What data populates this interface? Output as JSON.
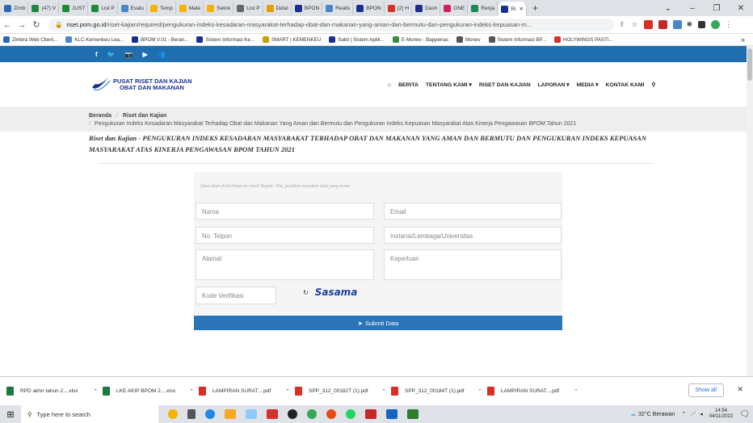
{
  "browser": {
    "tabs": [
      {
        "label": "Zimb",
        "color": "#2a6ab5"
      },
      {
        "label": "(47) V",
        "color": "#1b8a3a"
      },
      {
        "label": "JUST",
        "color": "#1b8a3a"
      },
      {
        "label": "List P",
        "color": "#1b8a3a"
      },
      {
        "label": "Evalu",
        "color": "#4a86c8"
      },
      {
        "label": "Temp",
        "color": "#f4b400"
      },
      {
        "label": "Mate",
        "color": "#f4b400"
      },
      {
        "label": "Sekre",
        "color": "#f4b400"
      },
      {
        "label": "List P",
        "color": "#666666"
      },
      {
        "label": "Detai",
        "color": "#e8a000"
      },
      {
        "label": "BPON",
        "color": "#1a2f8f"
      },
      {
        "label": "Realis",
        "color": "#4a86c8"
      },
      {
        "label": "BPON",
        "color": "#1a2f8f"
      },
      {
        "label": "(2) H",
        "color": "#d93025"
      },
      {
        "label": "Dash",
        "color": "#1a2f8f"
      },
      {
        "label": "ONE",
        "color": "#d81b60"
      },
      {
        "label": "Renja",
        "color": "#1a8a55"
      },
      {
        "label": "Ri",
        "color": "#1a2f8f",
        "active": true
      }
    ],
    "new_tab": "+",
    "url_host": "riset.pom.go.id",
    "url_path": "/riset-kajian/required/pengukuran-indeks-kesadaran-masyarakat-terhadap-obat-dan-makanan-yang-aman-dan-bermutu-dan-pengukuran-indeks-kepuasan-m...",
    "bookmarks": [
      {
        "label": "Zimbra Web Client...",
        "color": "#2a6ab5"
      },
      {
        "label": "KLC-Kemenkeu Lea...",
        "color": "#4a86c8"
      },
      {
        "label": "BPOM V.01 - Beran...",
        "color": "#1a2f8f"
      },
      {
        "label": "Sistem Informasi Ke...",
        "color": "#1a2f8f"
      },
      {
        "label": "SMART | KEMENKEU",
        "color": "#c8a000"
      },
      {
        "label": "Sakti | Sistem Aplik...",
        "color": "#1a2f8f"
      },
      {
        "label": "E-Monev - Bappenas",
        "color": "#3c8a3c"
      },
      {
        "label": "Monev",
        "color": "#555555"
      },
      {
        "label": "Sistem Informasi BP...",
        "color": "#555555"
      },
      {
        "label": "HOLYWINGS PASTI...",
        "color": "#d93025"
      }
    ],
    "bookmarks_more": "»"
  },
  "site": {
    "logo_line1": "PUSAT RISET DAN KAJIAN",
    "logo_line2": "OBAT DAN MAKANAN",
    "nav": [
      {
        "label": "BERITA",
        "dropdown": false
      },
      {
        "label": "TENTANG KAMI",
        "dropdown": true
      },
      {
        "label": "RISET DAN KAJIAN",
        "dropdown": false
      },
      {
        "label": "LAPORAN",
        "dropdown": true
      },
      {
        "label": "MEDIA",
        "dropdown": true
      },
      {
        "label": "KONTAK KAMI",
        "dropdown": false
      }
    ],
    "social": [
      "f",
      "🐦",
      "📷",
      "▶",
      "👥"
    ]
  },
  "breadcrumb": {
    "home": "Beranda",
    "section": "Riset dan Kajian",
    "current": "Pengukuran Indeks Kesadaran Masyarakat Terhadap Obat dan Makanan Yang Aman dan Bermutu dan Pengukuran Indeks Kepuasan Masyarakat Atas Kinerja Pengawasan BPOM Tahun 2021",
    "separator": "/"
  },
  "heading": "Riset dan Kajian - PENGUKURAN INDEKS KESADARAN MASYARAKAT TERHADAP OBAT DAN MAKANAN YANG AMAN DAN BERMUTU DAN PENGUKURAN INDEKS KEPUASAN MASYARAKAT ATAS KINERJA PENGAWASAN BPOM TAHUN 2021",
  "form": {
    "note": "Data akan di kirimkan ke email Bapak / Ibu, pastikan masukan data yang benar",
    "nama_placeholder": "Nama",
    "email_placeholder": "Email",
    "telpon_placeholder": "No. Telpon",
    "instansi_placeholder": "Instansi/Lembaga/Universitas",
    "alamat_placeholder": "Alamat",
    "keperluan_placeholder": "Keperluan",
    "kode_placeholder": "Kode Verifikasi",
    "captcha_text": "Sasama",
    "submit_label": "Submit Data"
  },
  "downloads": {
    "items": [
      {
        "label": "RPD akhir tahun 2....xlsx",
        "color": "#1e7a3c"
      },
      {
        "label": "LKE AKIP BPOM 2....xlsx",
        "color": "#1e7a3c"
      },
      {
        "label": "LAMPIRAN SURAT....pdf",
        "color": "#d93025"
      },
      {
        "label": "SPP_312_00182T (1).pdf",
        "color": "#d93025"
      },
      {
        "label": "SPP_312_00184T (1).pdf",
        "color": "#d93025"
      },
      {
        "label": "LAMPIRAN SURAT....pdf",
        "color": "#d93025"
      }
    ],
    "show_all": "Show all"
  },
  "taskbar": {
    "search_placeholder": "Type here to search",
    "weather": "32°C Berawan",
    "time": "14:54",
    "date": "04/11/2022"
  }
}
